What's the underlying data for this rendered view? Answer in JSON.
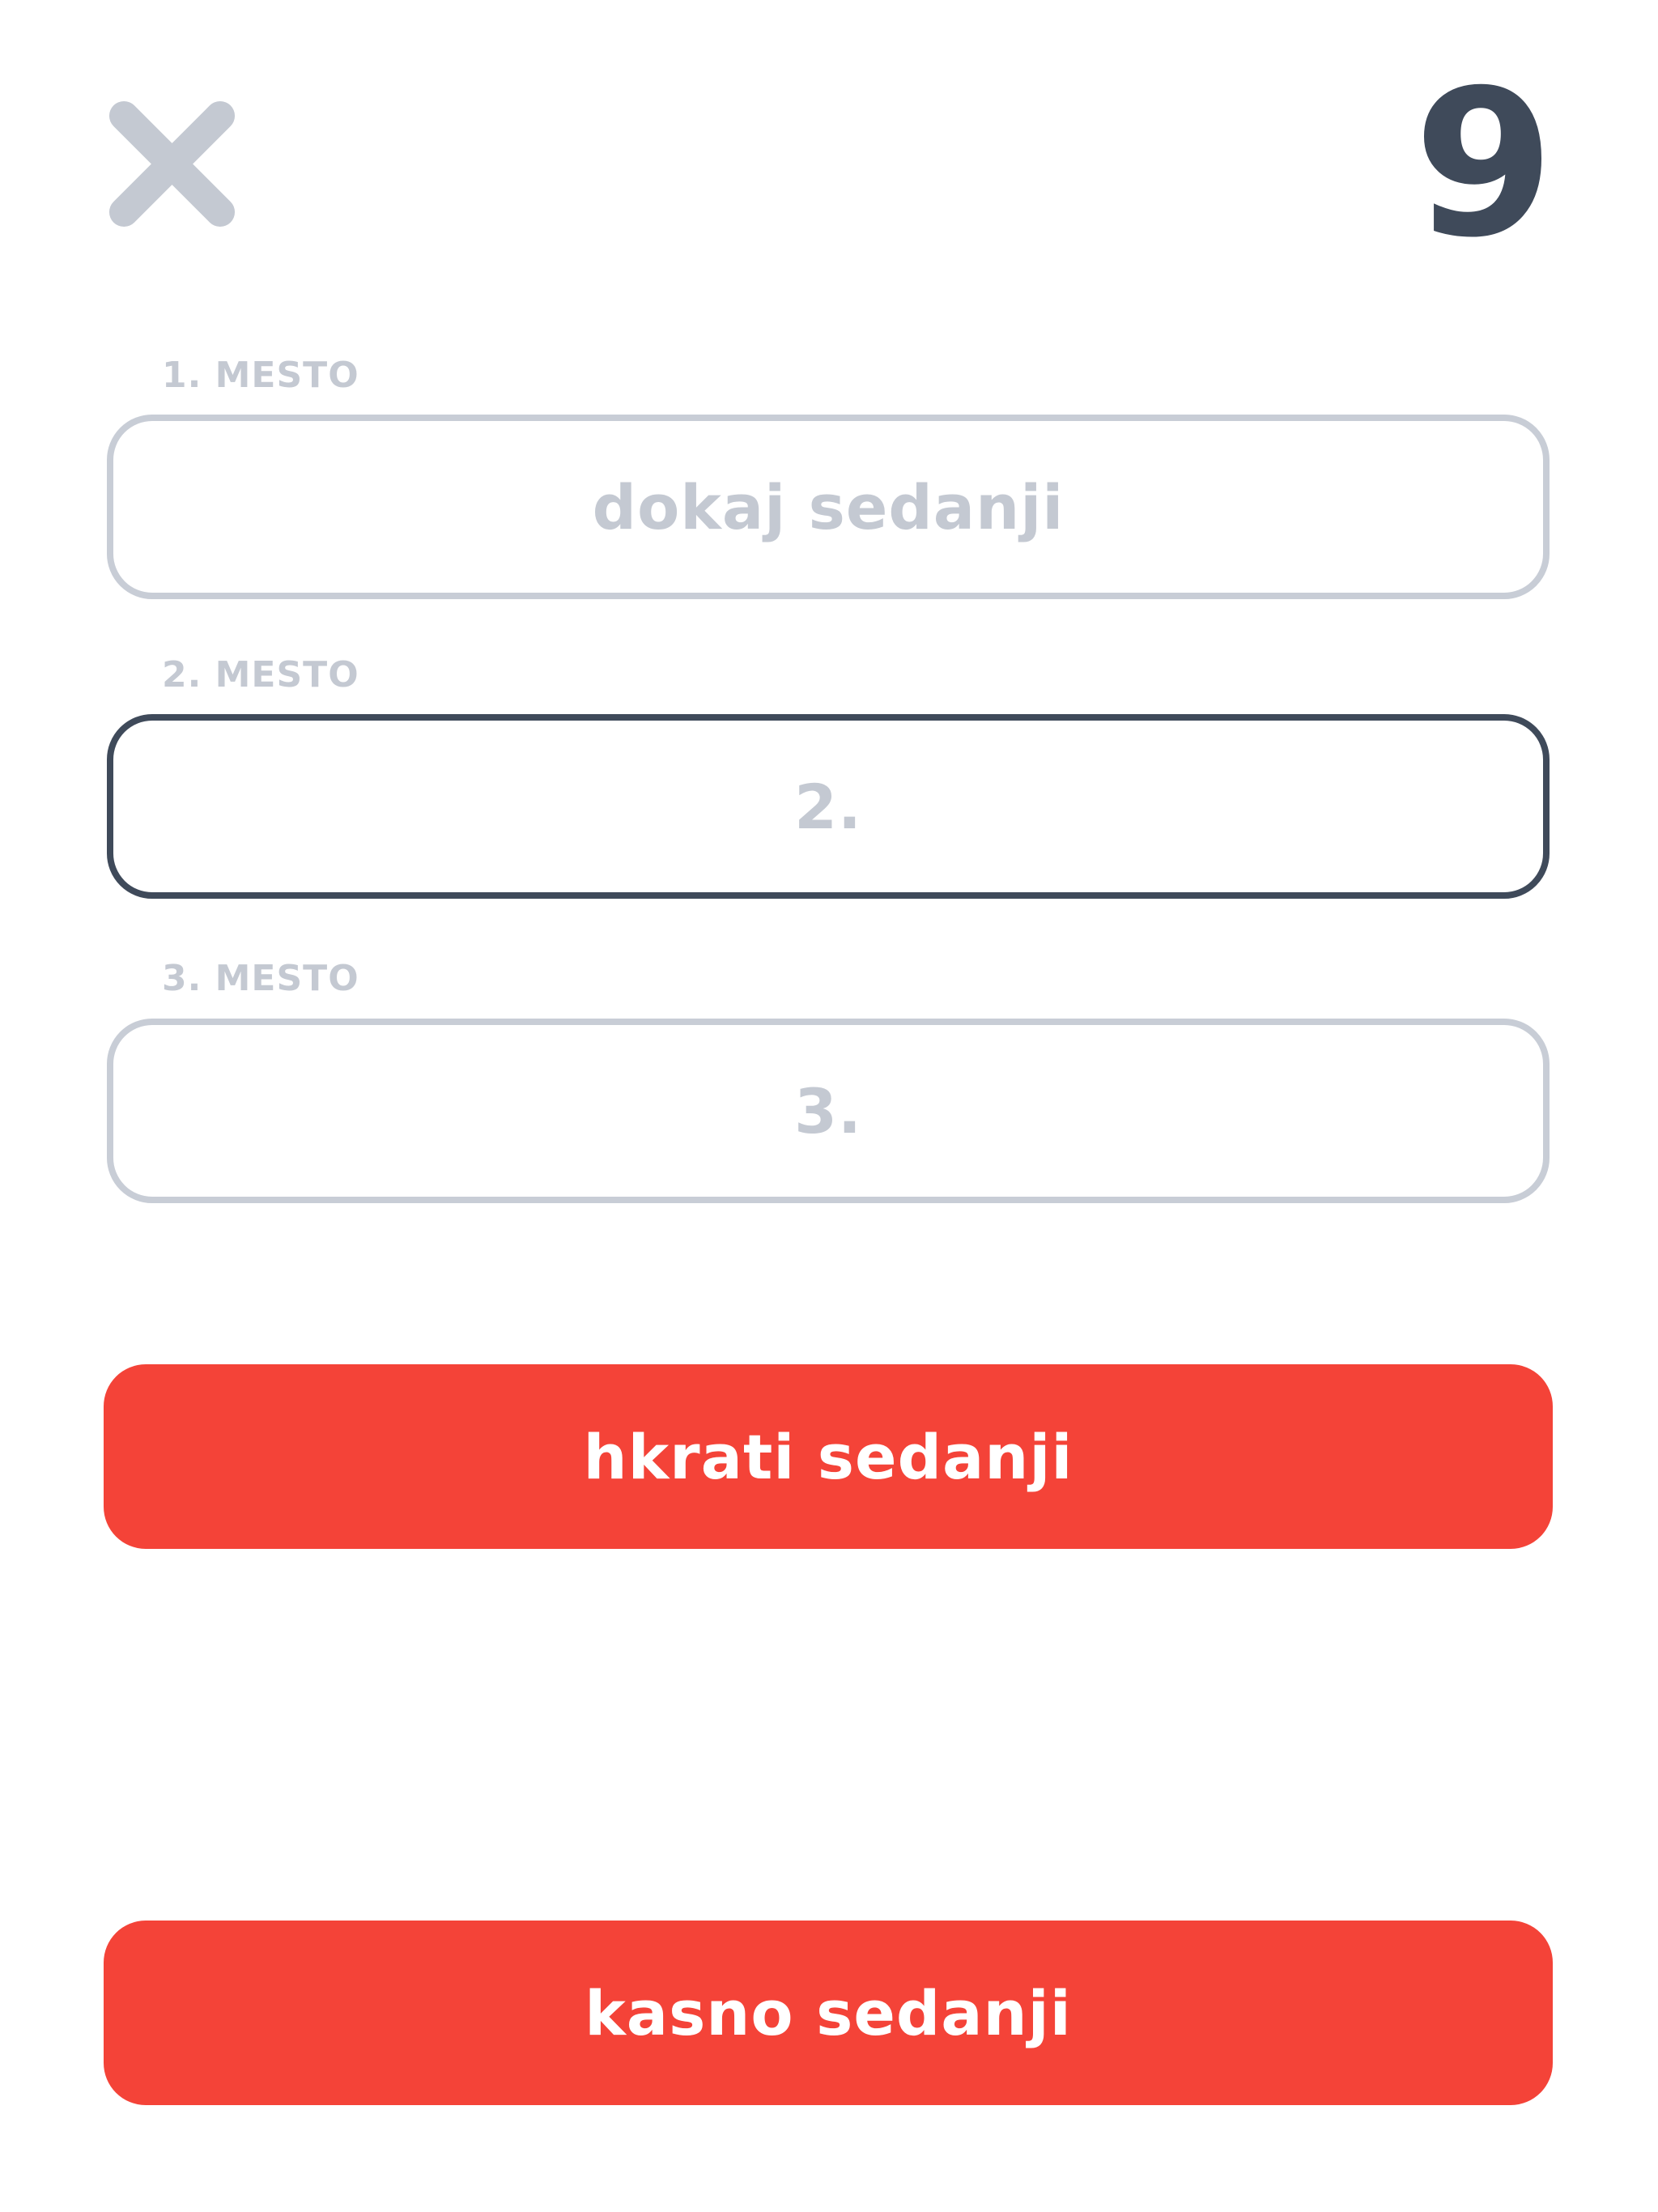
{
  "header": {
    "close_icon": "close-icon",
    "counter": "9"
  },
  "fields": [
    {
      "label": "1. MESTO",
      "value": "dokaj sedanji",
      "active": false
    },
    {
      "label": "2. MESTO",
      "value": "2.",
      "active": true
    },
    {
      "label": "3. MESTO",
      "value": "3.",
      "active": false
    }
  ],
  "buttons": {
    "primary_label": "hkrati sedanji",
    "secondary_label": "kasno sedanji"
  },
  "colors": {
    "accent": "#f44338",
    "text_dark": "#3f4a5a",
    "text_muted": "#c4c9d2",
    "border_muted": "#c8cdd6"
  }
}
